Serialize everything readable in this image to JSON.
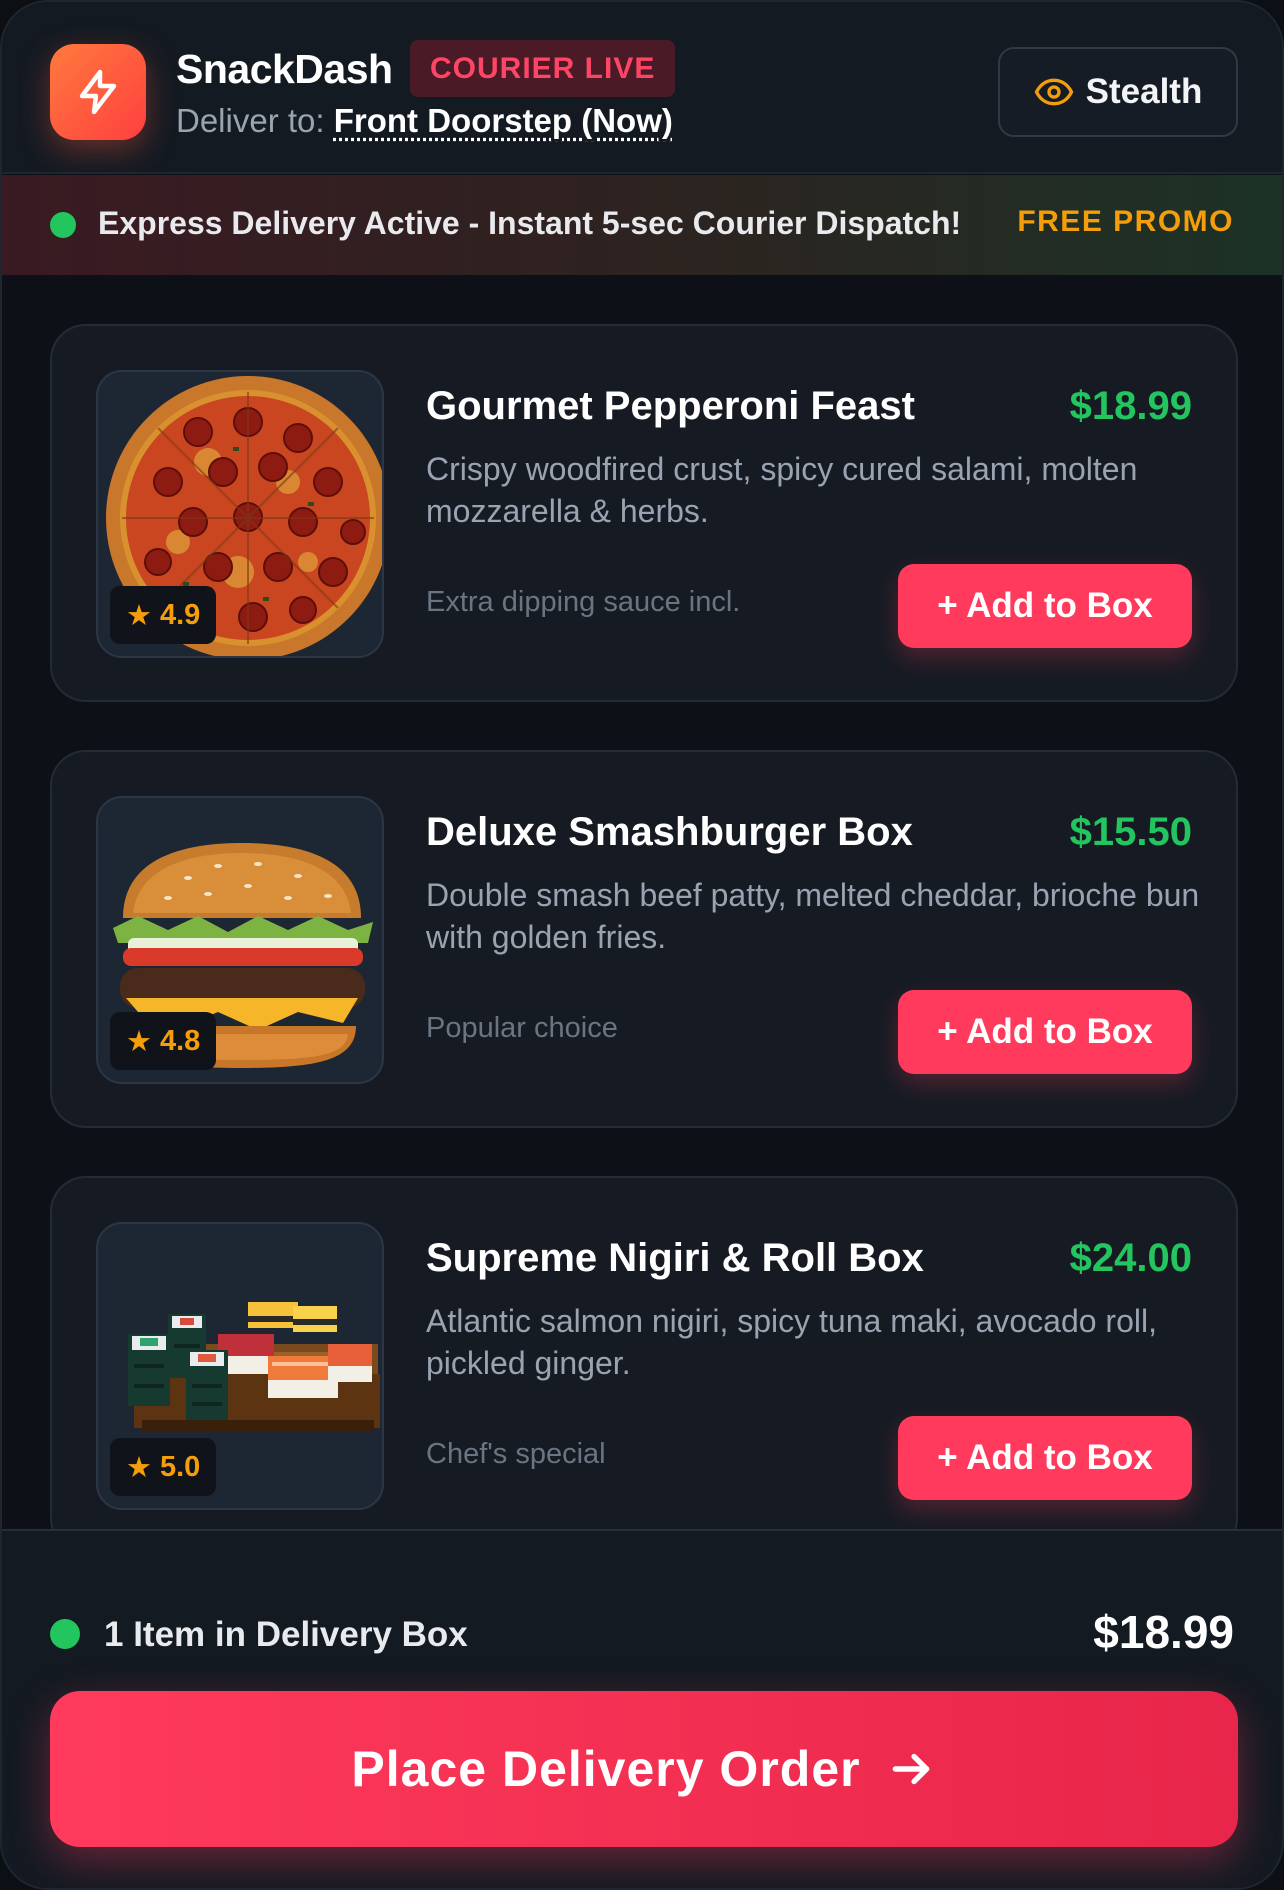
{
  "header": {
    "brand": "SnackDash",
    "live_badge": "COURIER LIVE",
    "deliver_label": "Deliver to:",
    "deliver_address": "Front Doorstep (Now)",
    "stealth_label": "Stealth",
    "logo_icon": "lightning-bolt-icon",
    "stealth_icon": "eye-icon"
  },
  "promo": {
    "text": "Express Delivery Active - Instant 5-sec Courier Dispatch!",
    "tag": "FREE PROMO"
  },
  "items": [
    {
      "title": "Gourmet Pepperoni Feast",
      "price": "$18.99",
      "description": "Crispy woodfired crust, spicy cured salami, molten mozzarella & herbs.",
      "note": "Extra dipping sauce incl.",
      "rating": "4.9",
      "button": "+ Add to Box",
      "image": "pepperoni-pizza"
    },
    {
      "title": "Deluxe Smashburger Box",
      "price": "$15.50",
      "description": "Double smash beef patty, melted cheddar, brioche bun with golden fries.",
      "note": "Popular choice",
      "rating": "4.8",
      "button": "+ Add to Box",
      "image": "cheeseburger"
    },
    {
      "title": "Supreme Nigiri & Roll Box",
      "price": "$24.00",
      "description": "Atlantic salmon nigiri, spicy tuna maki, avocado roll, pickled ginger.",
      "note": "Chef's special",
      "rating": "5.0",
      "button": "+ Add to Box",
      "image": "pixel-sushi-platter"
    }
  ],
  "cart": {
    "count_label": "1 Item in Delivery Box",
    "total": "$18.99"
  },
  "order_button": {
    "label": "Place Delivery Order",
    "icon": "arrow-right-icon"
  },
  "colors": {
    "accent": "#ff3a5c",
    "price": "#22c55e",
    "rating": "#f59e0b",
    "background": "#0d1117"
  }
}
